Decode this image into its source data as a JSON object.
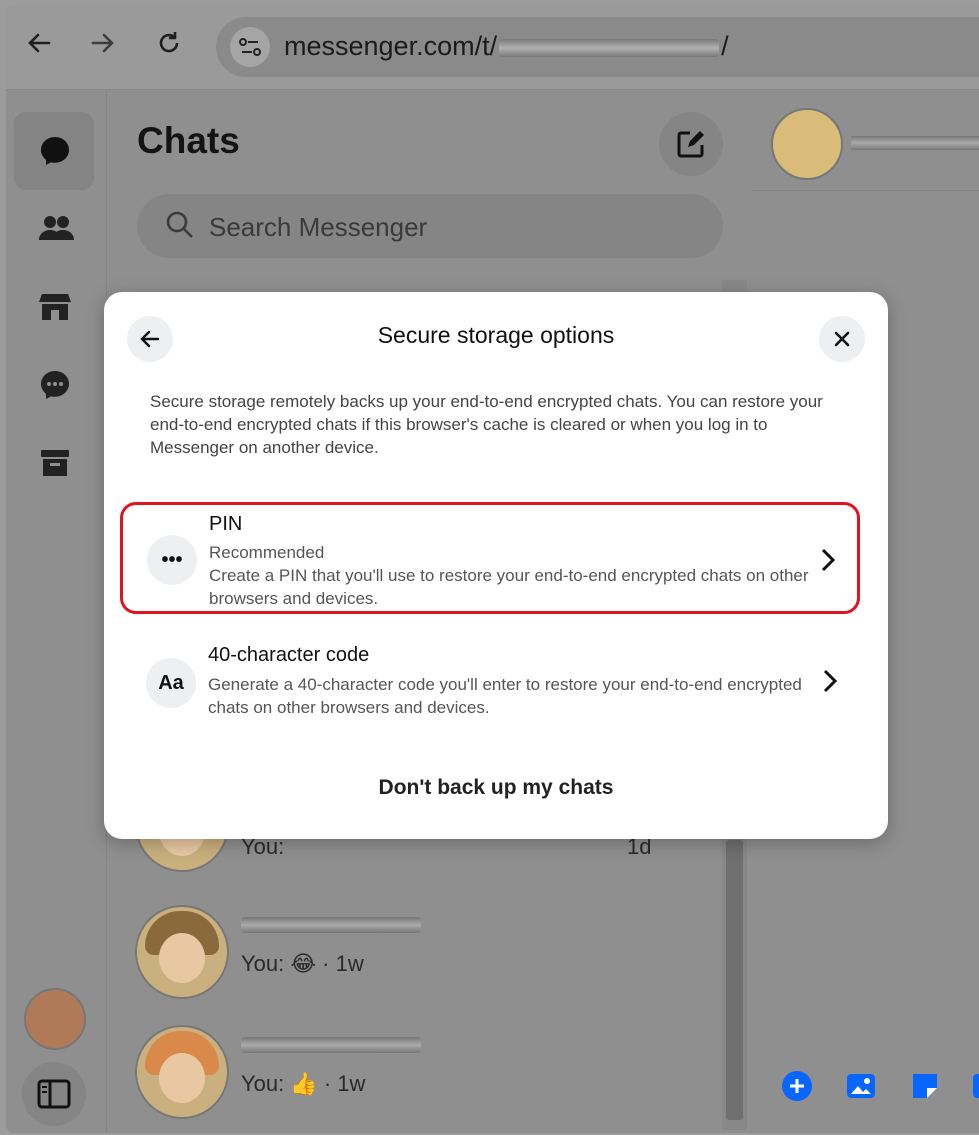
{
  "browser": {
    "url_prefix": "messenger.com/t/",
    "url_suffix": "/"
  },
  "chat_list": {
    "title": "Chats",
    "search_placeholder": "Search Messenger",
    "rows": [
      {
        "message": "You:",
        "time": "1d"
      },
      {
        "message": "You: 😂 · 1w"
      },
      {
        "message": "You: 👍 · 1w"
      }
    ]
  },
  "modal": {
    "title": "Secure storage options",
    "description": "Secure storage remotely backs up your end-to-end encrypted chats. You can restore your end-to-end encrypted chats if this browser's cache is cleared or when you log in to Messenger on another device.",
    "options": [
      {
        "icon_text": "•••",
        "title": "PIN",
        "badge": "Recommended",
        "subtitle": "Create a PIN that you'll use to restore your end-to-end encrypted chats on other browsers and devices."
      },
      {
        "icon_text": "Aa",
        "title": "40-character code",
        "subtitle": "Generate a 40-character code you'll enter to restore your end-to-end encrypted chats on other browsers and devices."
      }
    ],
    "footer_link": "Don't back up my chats"
  },
  "colors": {
    "highlight": "#e0141e",
    "accent": "#0866ff"
  }
}
